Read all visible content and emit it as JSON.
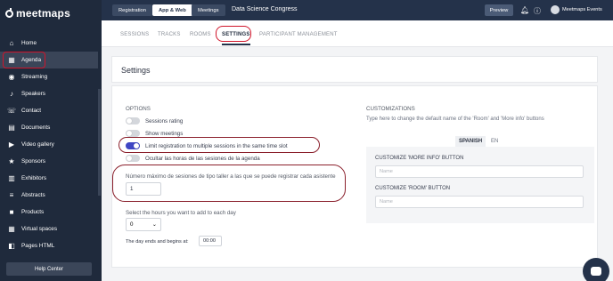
{
  "brand": {
    "logo_text": "meetmaps"
  },
  "sidebar": {
    "items": [
      {
        "label": "Home",
        "icon": "home-icon",
        "glyph": "⌂"
      },
      {
        "label": "Agenda",
        "icon": "calendar-icon",
        "glyph": "▦"
      },
      {
        "label": "Streaming",
        "icon": "broadcast-icon",
        "glyph": "◉"
      },
      {
        "label": "Speakers",
        "icon": "microphone-icon",
        "glyph": "♪"
      },
      {
        "label": "Contact",
        "icon": "contact-icon",
        "glyph": "☏"
      },
      {
        "label": "Documents",
        "icon": "document-icon",
        "glyph": "▤"
      },
      {
        "label": "Video gallery",
        "icon": "video-icon",
        "glyph": "▶"
      },
      {
        "label": "Sponsors",
        "icon": "star-icon",
        "glyph": "★"
      },
      {
        "label": "Exhibitors",
        "icon": "store-icon",
        "glyph": "▥"
      },
      {
        "label": "Abstracts",
        "icon": "abstract-icon",
        "glyph": "≡"
      },
      {
        "label": "Products",
        "icon": "box-icon",
        "glyph": "■"
      },
      {
        "label": "Virtual spaces",
        "icon": "grid-icon",
        "glyph": "▦"
      },
      {
        "label": "Pages HTML",
        "icon": "code-icon",
        "glyph": "◧"
      }
    ],
    "active_index": 1,
    "help_label": "Help Center"
  },
  "topbar": {
    "buttons": [
      "Registration",
      "App & Web",
      "Meetings"
    ],
    "selected": "App & Web",
    "event_name": "Data Science Congress",
    "preview_label": "Preview",
    "user_name": "Meetmaps Events"
  },
  "tabs": {
    "items": [
      "SESSIONS",
      "TRACKS",
      "ROOMS",
      "SETTINGS",
      "PARTICIPANT MANAGEMENT"
    ],
    "active": "SETTINGS"
  },
  "settings": {
    "title": "Settings",
    "options_label": "OPTIONS",
    "toggles": [
      {
        "label": "Sessions rating",
        "on": false
      },
      {
        "label": "Show meetings",
        "on": false
      },
      {
        "label": "Limit registration to multiple sessions in the same time slot",
        "on": true
      },
      {
        "label": "Ocultar las horas de las sesiones de la agenda",
        "on": false
      }
    ],
    "max_sessions_label": "Número máximo de sesiones de tipo taller a las que se puede registrar cada asistente",
    "max_sessions_value": "1",
    "hours_label": "Select the hours you want to add to each day",
    "hours_value": "0",
    "day_end_label": "The day ends and begins at:",
    "day_end_value": "00:00"
  },
  "customizations": {
    "label": "CUSTOMIZATIONS",
    "description": "Type here to change the default name of the 'Room' and 'More info' buttons",
    "languages": [
      "SPANISH",
      "EN"
    ],
    "active_language": "SPANISH",
    "more_info_label": "CUSTOMIZE 'MORE INFO' BUTTON",
    "more_info_placeholder": "Name",
    "room_label": "CUSTOMIZE 'ROOM' BUTTON",
    "room_placeholder": "Name"
  },
  "colors": {
    "sidebar": "#1f2a3c",
    "accent": "#3f46c4",
    "highlight": "#d0142a"
  }
}
